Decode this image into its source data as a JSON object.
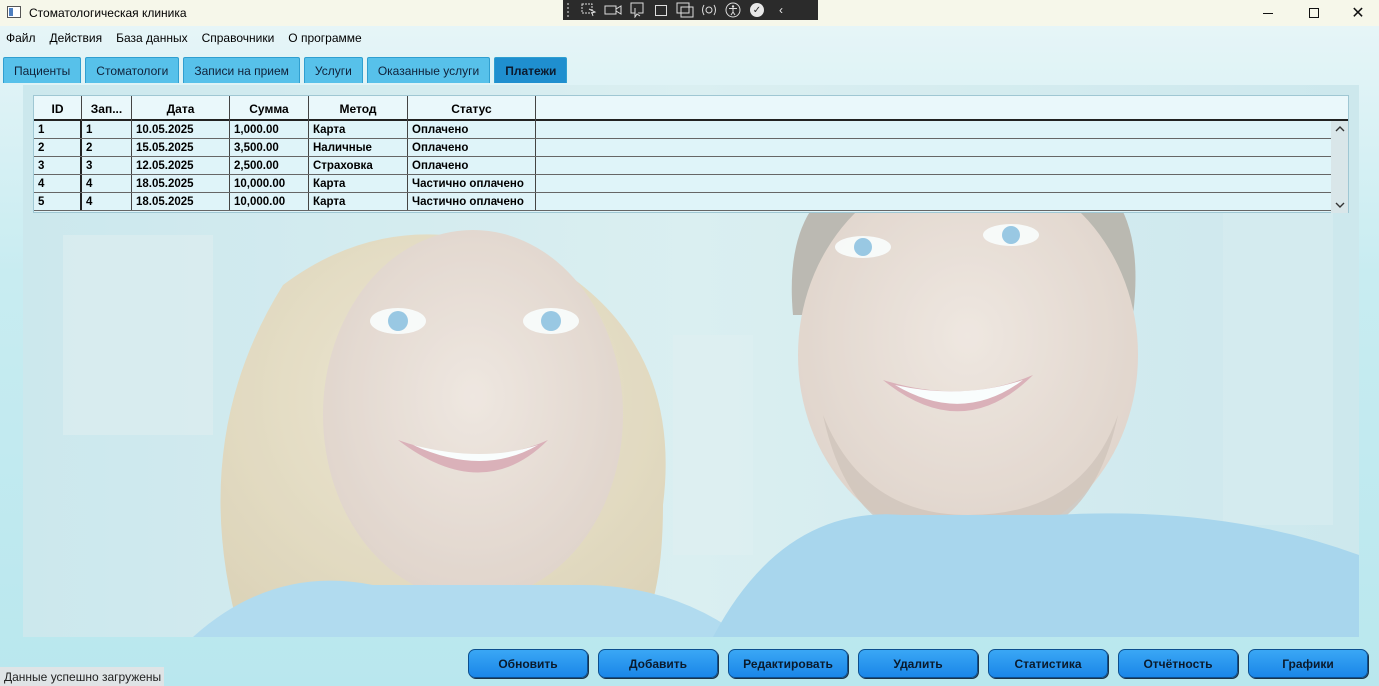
{
  "window": {
    "title": "Стоматологическая клиника",
    "minimize_glyph": "—",
    "close_glyph": "✕"
  },
  "debug_toolbar": {
    "icons": [
      "select-element-icon",
      "video-icon",
      "pointer-icon",
      "layout-adorner-icon",
      "track-focus-icon",
      "binding-failures-icon",
      "accessibility-icon",
      "check-icon",
      "collapse-icon"
    ],
    "collapse_glyph": "‹"
  },
  "menu": {
    "items": [
      "Файл",
      "Действия",
      "База данных",
      "Справочники",
      "О программе"
    ]
  },
  "tabs": [
    {
      "label": "Пациенты",
      "active": false
    },
    {
      "label": "Стоматологи",
      "active": false
    },
    {
      "label": "Записи на прием",
      "active": false
    },
    {
      "label": "Услуги",
      "active": false
    },
    {
      "label": "Оказанные услуги",
      "active": false
    },
    {
      "label": "Платежи",
      "active": true
    }
  ],
  "grid": {
    "columns": [
      "ID",
      "Зап...",
      "Дата",
      "Сумма",
      "Метод",
      "Статус"
    ],
    "rows": [
      [
        "1",
        "1",
        "10.05.2025",
        "1,000.00",
        "Карта",
        "Оплачено"
      ],
      [
        "2",
        "2",
        "15.05.2025",
        "3,500.00",
        "Наличные",
        "Оплачено"
      ],
      [
        "3",
        "3",
        "12.05.2025",
        "2,500.00",
        "Страховка",
        "Оплачено"
      ],
      [
        "4",
        "4",
        "18.05.2025",
        "10,000.00",
        "Карта",
        "Частично оплачено"
      ],
      [
        "5",
        "4",
        "18.05.2025",
        "10,000.00",
        "Карта",
        "Частично оплачено"
      ]
    ],
    "scroll_up_glyph": "⌃",
    "scroll_down_glyph": "⌄"
  },
  "buttons": {
    "refresh": "Обновить",
    "add": "Добавить",
    "edit": "Редактировать",
    "delete": "Удалить",
    "statistics": "Статистика",
    "reports": "Отчётность",
    "charts": "Графики"
  },
  "status": {
    "message": "Данные успешно загружены"
  },
  "colors": {
    "tab": "#57c1ea",
    "tab_active": "#1f8fcf",
    "button": "#1a86e8"
  }
}
